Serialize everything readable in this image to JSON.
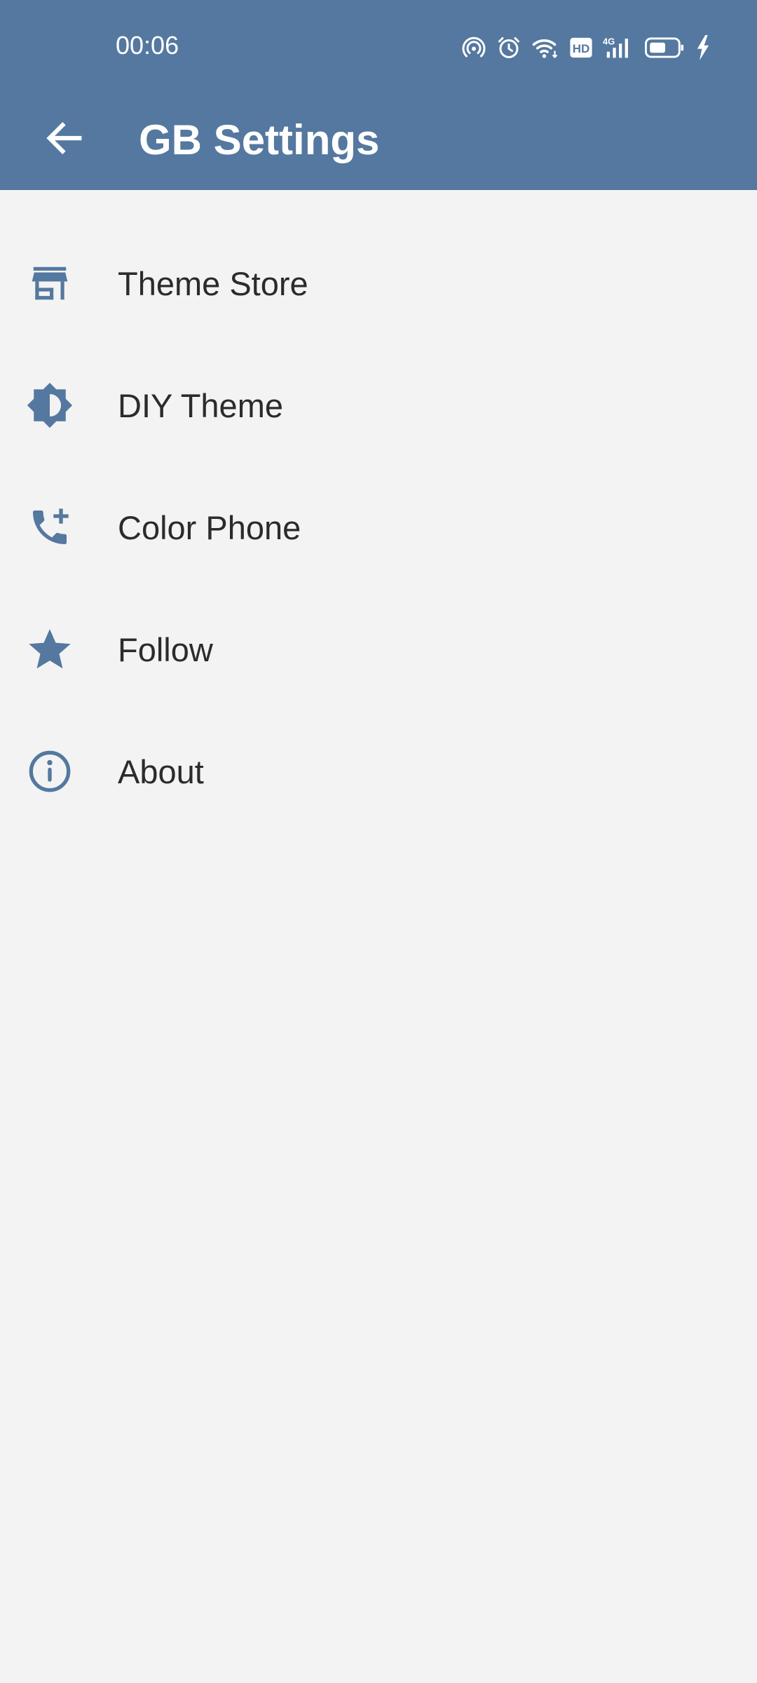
{
  "status_bar": {
    "time": "00:06",
    "icons": [
      "hotspot-icon",
      "alarm-icon",
      "wifi-icon",
      "hd-icon",
      "signal-4g-icon",
      "battery-icon",
      "charging-icon"
    ],
    "hd_label": "HD",
    "network_label": "4G"
  },
  "toolbar": {
    "title": "GB Settings",
    "back_icon": "arrow-back-icon"
  },
  "menu": {
    "items": [
      {
        "label": "Theme Store",
        "icon": "store-icon"
      },
      {
        "label": "DIY Theme",
        "icon": "brightness-icon"
      },
      {
        "label": "Color Phone",
        "icon": "add-call-icon"
      },
      {
        "label": "Follow",
        "icon": "star-icon"
      },
      {
        "label": "About",
        "icon": "info-icon"
      }
    ]
  },
  "colors": {
    "primary": "#54789f",
    "background": "#f3f3f3",
    "text": "#2b2b2b",
    "icon": "#54789f"
  }
}
